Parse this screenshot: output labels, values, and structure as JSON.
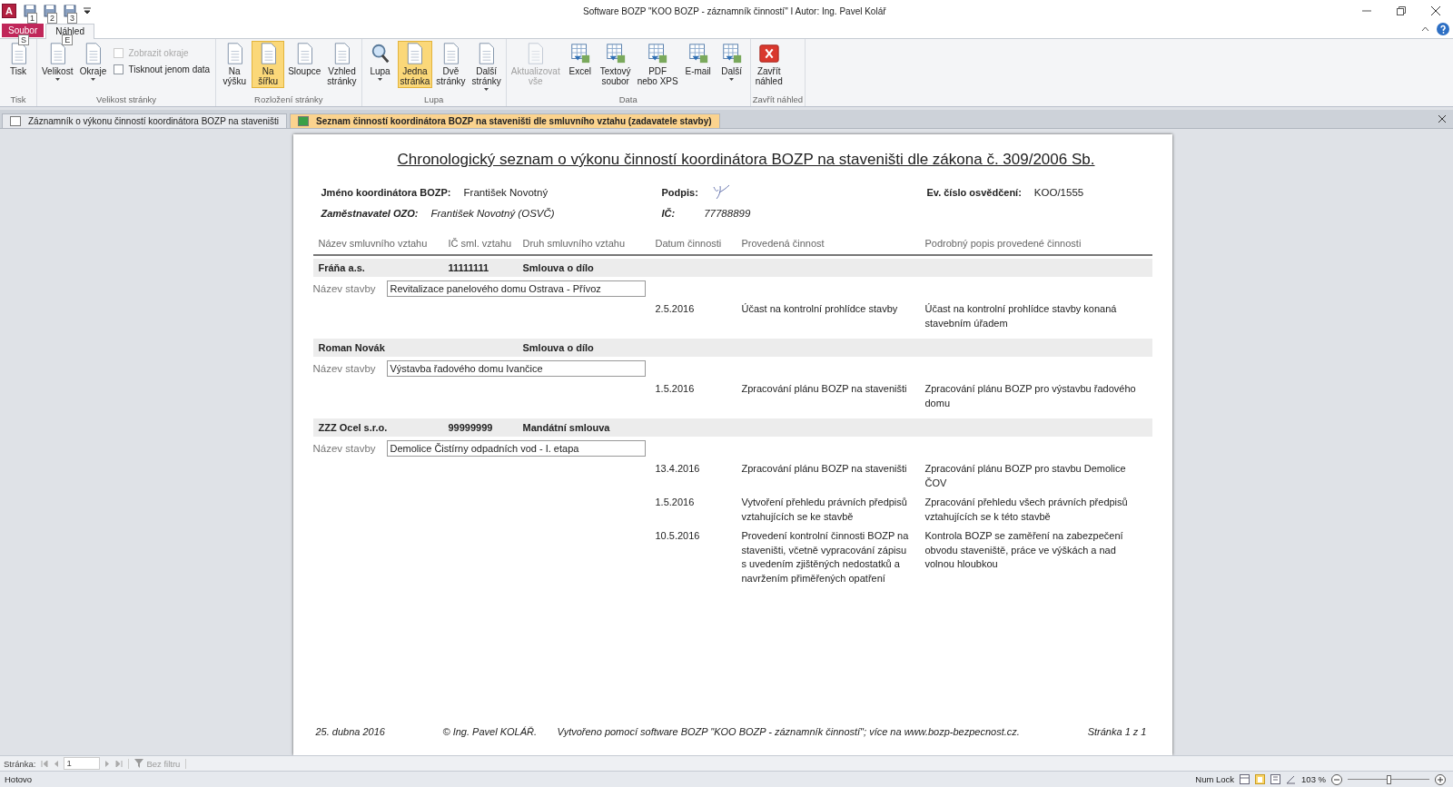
{
  "window": {
    "title": "Software BOZP \"KOO BOZP - záznamník činností\" I Autor: Ing. Pavel Kolář"
  },
  "app_logo": {
    "letter": "A"
  },
  "quick_access": [
    {
      "keytip": "1"
    },
    {
      "keytip": "2"
    },
    {
      "keytip": "3"
    }
  ],
  "ribbon_tabs": [
    {
      "label": "Soubor",
      "kind": "file",
      "selected": false,
      "keytip": "S"
    },
    {
      "label": "Náhled",
      "kind": "tab",
      "selected": true,
      "keytip": "E"
    }
  ],
  "ribbon_groups": [
    {
      "label": "Tisk",
      "items": [
        {
          "kind": "large",
          "label": "Tisk",
          "selected": false,
          "disabled": false,
          "dropdown": false
        }
      ]
    },
    {
      "label": "Velikost stránky",
      "items": [
        {
          "kind": "large",
          "label": "Velikost",
          "selected": false,
          "disabled": false,
          "dropdown": true
        },
        {
          "kind": "large",
          "label": "Okraje",
          "selected": false,
          "disabled": false,
          "dropdown": true
        },
        {
          "kind": "checks",
          "options": [
            {
              "label": "Zobrazit okraje",
              "checked": false,
              "disabled": true
            },
            {
              "label": "Tisknout jenom data",
              "checked": false,
              "disabled": false
            }
          ]
        }
      ]
    },
    {
      "label": "Rozložení stránky",
      "items": [
        {
          "kind": "large",
          "label": "Na\nvýšku",
          "selected": false,
          "disabled": false,
          "dropdown": false
        },
        {
          "kind": "large",
          "label": "Na\nšířku",
          "selected": true,
          "disabled": false,
          "dropdown": false
        },
        {
          "kind": "large",
          "label": "Sloupce",
          "selected": false,
          "disabled": false,
          "dropdown": false
        },
        {
          "kind": "large",
          "label": "Vzhled\nstránky",
          "selected": false,
          "disabled": false,
          "dropdown": false
        }
      ]
    },
    {
      "label": "Lupa",
      "items": [
        {
          "kind": "zoom",
          "label": "Lupa",
          "selected": false,
          "disabled": false,
          "dropdown": true
        },
        {
          "kind": "large",
          "label": "Jedna\nstránka",
          "selected": true,
          "disabled": false,
          "dropdown": false
        },
        {
          "kind": "large",
          "label": "Dvě\nstránky",
          "selected": false,
          "disabled": false,
          "dropdown": false
        },
        {
          "kind": "large",
          "label": "Další\nstránky",
          "selected": false,
          "disabled": false,
          "dropdown": true
        }
      ]
    },
    {
      "label": "Data",
      "items": [
        {
          "kind": "large",
          "label": "Aktualizovat\nvše",
          "selected": false,
          "disabled": true,
          "dropdown": false
        },
        {
          "kind": "export",
          "label": "Excel",
          "selected": false,
          "disabled": false,
          "dropdown": false
        },
        {
          "kind": "export",
          "label": "Textový\nsoubor",
          "selected": false,
          "disabled": false,
          "dropdown": false
        },
        {
          "kind": "export",
          "label": "PDF\nnebo XPS",
          "selected": false,
          "disabled": false,
          "dropdown": false
        },
        {
          "kind": "export",
          "label": "E-mail",
          "selected": false,
          "disabled": false,
          "dropdown": false
        },
        {
          "kind": "export",
          "label": "Další",
          "selected": false,
          "disabled": false,
          "dropdown": true
        }
      ]
    },
    {
      "label": "Zavřít náhled",
      "items": [
        {
          "kind": "close",
          "label": "Zavřít\nnáhled",
          "selected": false,
          "disabled": false,
          "dropdown": false
        }
      ]
    }
  ],
  "doc_tabs": [
    {
      "label": "Záznamník o výkonu činností koordinátora BOZP na staveništi",
      "selected": false
    },
    {
      "label": "Seznam činností koordinátora BOZP na staveništi dle smluvního vztahu (zadavatele stavby)",
      "selected": true
    }
  ],
  "report": {
    "title": "Chronologický seznam o výkonu činností koordinátora BOZP na staveništi dle zákona č. 309/2006 Sb.",
    "header_rows": [
      {
        "italic": false,
        "fields": [
          {
            "kind": "text",
            "label": "Jméno koordinátora BOZP:",
            "value": "František Novotný"
          },
          {
            "kind": "signature",
            "label": "Podpis:"
          },
          {
            "kind": "text",
            "label": "Ev. číslo osvědčení:",
            "value": "KOO/1555"
          }
        ]
      },
      {
        "italic": true,
        "fields": [
          {
            "kind": "text",
            "label": "Zaměstnavatel OZO:",
            "value": "František Novotný (OSVČ)"
          },
          {
            "kind": "text",
            "label": "IČ:",
            "value": "77788899"
          }
        ]
      }
    ],
    "columns": [
      "Název smluvního vztahu",
      "IČ sml. vztahu",
      "Druh smluvního vztahu",
      "Datum činnosti",
      "Provedená činnost",
      "Podrobný popis provedené činnosti"
    ],
    "contracts": [
      {
        "name": "Fráňa a.s.",
        "ic": "11111111",
        "type": "Smlouva o dílo",
        "building_label": "Název stavby",
        "building": "Revitalizace panelového domu Ostrava - Přívoz",
        "activities": [
          {
            "date": "2.5.2016",
            "activity": "Účast na kontrolní prohlídce stavby",
            "description": "Účast na kontrolní prohlídce stavby konaná stavebním úřadem"
          }
        ]
      },
      {
        "name": "Roman Novák",
        "type": "Smlouva o dílo",
        "building_label": "Název stavby",
        "building": "Výstavba řadového domu Ivančice",
        "activities": [
          {
            "date": "1.5.2016",
            "activity": "Zpracování plánu BOZP na staveništi",
            "description": "Zpracování plánu BOZP pro výstavbu řadového domu"
          }
        ]
      },
      {
        "name": "ZZZ Ocel s.r.o.",
        "ic": "99999999",
        "type": "Mandátní smlouva",
        "building_label": "Název stavby",
        "building": "Demolice Čistírny odpadních vod - I. etapa",
        "activities": [
          {
            "date": "13.4.2016",
            "activity": "Zpracování plánu BOZP na staveništi",
            "description": "Zpracování plánu BOZP pro stavbu Demolice ČOV"
          },
          {
            "date": "1.5.2016",
            "activity": "Vytvoření přehledu právních předpisů vztahujících se ke stavbě",
            "description": "Zpracování přehledu všech právních předpisů vztahujících se k této stavbě"
          },
          {
            "date": "10.5.2016",
            "activity": "Provedení kontrolní činnosti BOZP na staveništi, včetně vypracování zápisu s uvedením zjištěných nedostatků a navržením přiměřených opatření",
            "description": "Kontrola BOZP se zaměření na  zabezpečení obvodu staveniště, práce ve výškách a nad volnou hloubkou"
          }
        ]
      }
    ],
    "footer": {
      "date": "25. dubna 2016",
      "copyright": "© Ing. Pavel KOLÁŘ.",
      "note": "Vytvořeno pomocí software BOZP \"KOO BOZP - záznamník činností\"; více na www.bozp-bezpecnost.cz.",
      "page": "Stránka 1 z 1"
    }
  },
  "navigation": {
    "label": "Stránka:",
    "page": "1",
    "filter": "Bez filtru"
  },
  "status_bar": {
    "state": "Hotovo",
    "num_lock": "Num Lock",
    "zoom": "103 %",
    "zoom_slider": {
      "level": 0.5
    }
  }
}
